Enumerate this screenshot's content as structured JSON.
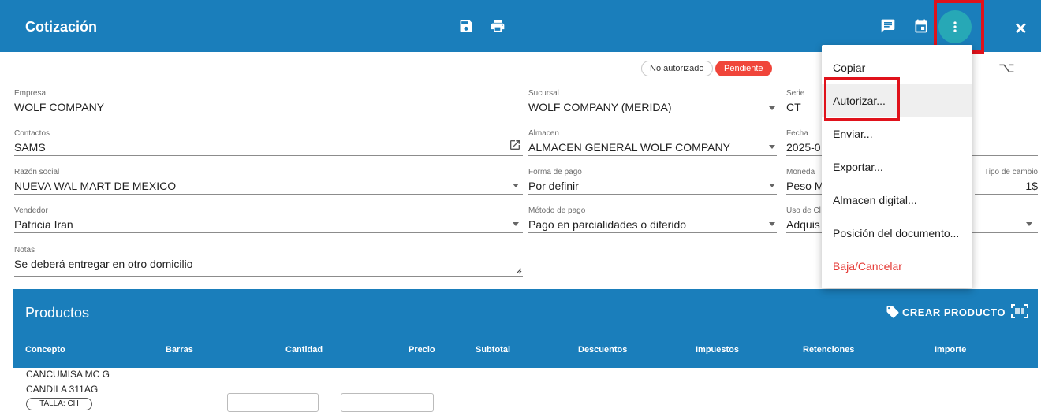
{
  "header": {
    "title": "Cotización",
    "close_glyph": "✕",
    "icons": [
      "save-icon",
      "print-icon",
      "message-icon",
      "calendar-icon",
      "more-vert-icon",
      "close-icon"
    ]
  },
  "status": {
    "not_authorized": "No autorizado",
    "pending": "Pendiente"
  },
  "form": {
    "empresa": {
      "label": "Empresa",
      "value": "WOLF COMPANY"
    },
    "sucursal": {
      "label": "Sucursal",
      "value": "WOLF COMPANY (MERIDA)"
    },
    "serie": {
      "label": "Serie",
      "value": "CT"
    },
    "contactos": {
      "label": "Contactos",
      "value": "SAMS"
    },
    "almacen": {
      "label": "Almacen",
      "value": "ALMACEN GENERAL WOLF COMPANY"
    },
    "fecha": {
      "label": "Fecha",
      "value": "2025-0"
    },
    "razon_social": {
      "label": "Razón social",
      "value": "NUEVA WAL MART DE MEXICO"
    },
    "forma_pago": {
      "label": "Forma de pago",
      "value": "Por definir"
    },
    "moneda": {
      "label": "Moneda",
      "value": "Peso M"
    },
    "tipo_cambio": {
      "label": "Tipo de cambio",
      "value": "1$"
    },
    "vendedor": {
      "label": "Vendedor",
      "value": "Patricia Iran"
    },
    "metodo_pago": {
      "label": "Método de pago",
      "value": "Pago en parcialidades o diferido"
    },
    "uso_cfdi": {
      "label": "Uso de Cl",
      "value": "Adquis"
    },
    "notas": {
      "label": "Notas",
      "value": "Se deberá entregar en otro domicilio"
    }
  },
  "products": {
    "title": "Productos",
    "create_button": "CREAR PRODUCTO",
    "columns": [
      "Concepto",
      "Barras",
      "Cantidad",
      "Precio",
      "Subtotal",
      "Descuentos",
      "Impuestos",
      "Retenciones",
      "Importe"
    ],
    "rows": [
      {
        "line1": "CANCUMISA MC G",
        "line2": "CANDILA 311AG",
        "tag": "TALLA: CH"
      }
    ]
  },
  "menu": {
    "items": [
      {
        "label": "Copiar",
        "highlighted": false,
        "danger": false
      },
      {
        "label": "Autorizar...",
        "highlighted": true,
        "danger": false
      },
      {
        "label": "Enviar...",
        "highlighted": false,
        "danger": false
      },
      {
        "label": "Exportar...",
        "highlighted": false,
        "danger": false
      },
      {
        "label": "Almacen digital...",
        "highlighted": false,
        "danger": false
      },
      {
        "label": "Posición del documento...",
        "highlighted": false,
        "danger": false
      },
      {
        "label": "Baja/Cancelar",
        "highlighted": false,
        "danger": true
      }
    ]
  },
  "colors": {
    "primary": "#1a7ebb",
    "accent_kebab": "#27a8b6",
    "pending_red": "#f0453a",
    "danger_text": "#e53935",
    "annotation_red": "#e0121b"
  }
}
